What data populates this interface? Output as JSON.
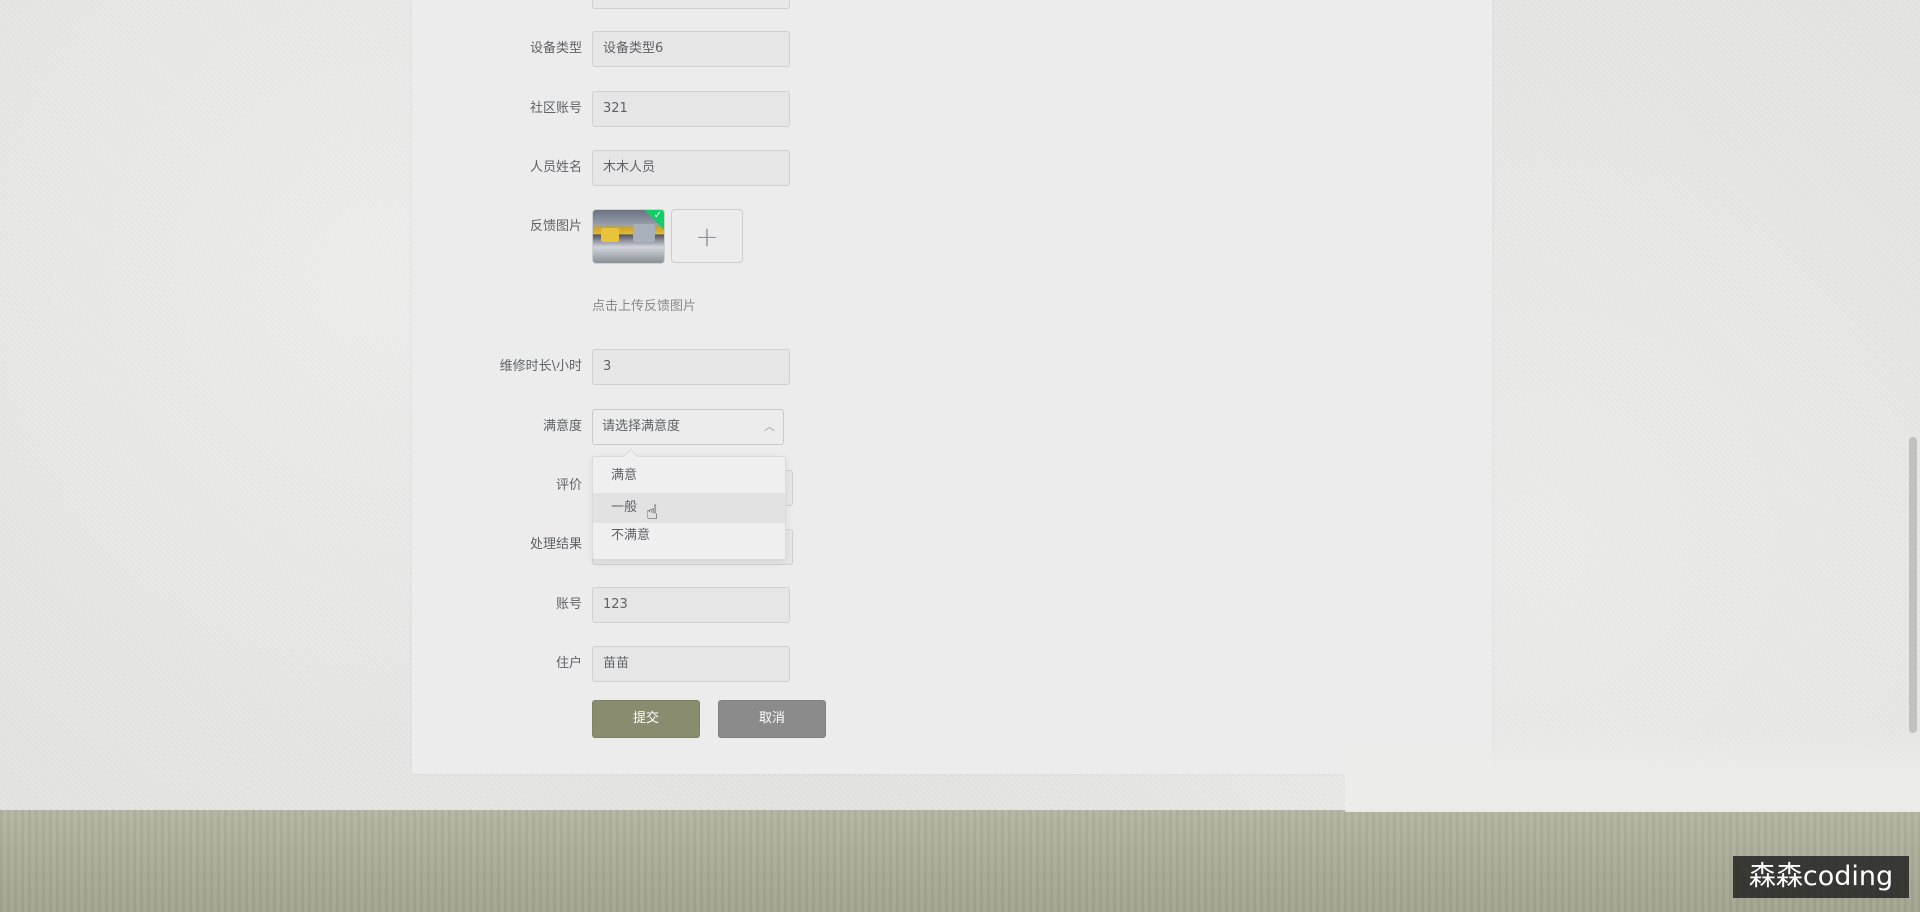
{
  "form": {
    "fields": [
      {
        "label": "设备类型",
        "value": "设备类型6"
      },
      {
        "label": "社区账号",
        "value": "321"
      },
      {
        "label": "人员姓名",
        "value": "木木人员"
      }
    ],
    "feedback_image_label": "反馈图片",
    "upload_hint": "点击上传反馈图片",
    "repair_hours_label": "维修时长\\小时",
    "repair_hours_value": "3",
    "satisfaction_label": "满意度",
    "satisfaction_placeholder": "请选择满意度",
    "evaluation_label": "评价",
    "result_label": "处理结果",
    "account_label": "账号",
    "account_value": "123",
    "resident_label": "住户",
    "resident_value": "苗苗",
    "submit_label": "提交",
    "cancel_label": "取消"
  },
  "dropdown": {
    "options": [
      "满意",
      "一般",
      "不满意"
    ],
    "hovered": "一般"
  },
  "icons": {
    "upload_check": "check-icon",
    "upload_add": "plus-icon",
    "select_chevron": "chevron-up-icon",
    "cursor": "hand-pointer-icon"
  },
  "colors": {
    "submit": "#8a8c70",
    "cancel": "#8b8b8b",
    "success_badge": "#13ce66"
  },
  "watermark": "森森coding"
}
